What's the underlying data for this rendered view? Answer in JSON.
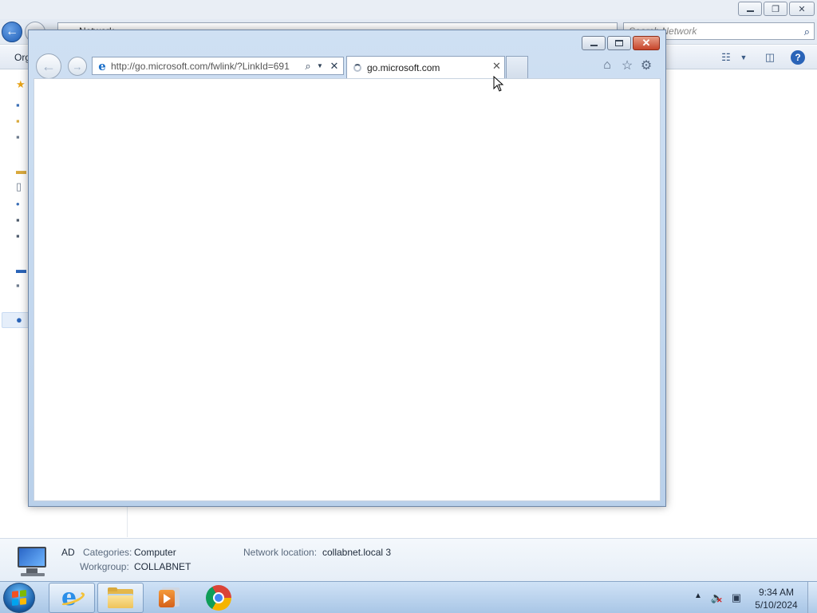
{
  "explorer": {
    "address_text": "Network",
    "search_placeholder": "Search Network",
    "organize_label": "Organize",
    "details": {
      "computer_name": "AD",
      "categories_label": "Categories:",
      "categories_value": "Computer",
      "workgroup_label": "Workgroup:",
      "workgroup_value": "COLLABNET",
      "network_location_label": "Network location:",
      "network_location_value": "collabnet.local 3"
    }
  },
  "ie": {
    "url": "http://go.microsoft.com/fwlink/?LinkId=691",
    "tab_title": "go.microsoft.com",
    "icons": [
      "back-icon",
      "forward-icon",
      "ie-favicon",
      "search-icon",
      "dropdown-icon",
      "stop-icon",
      "loading-spinner-icon",
      "close-tab-icon",
      "home-icon",
      "favorites-star-icon",
      "settings-gear-icon"
    ]
  },
  "taskbar": {
    "pinned": [
      "internet-explorer-icon",
      "windows-explorer-icon",
      "media-player-icon",
      "chrome-icon"
    ],
    "time": "9:34 AM",
    "date": "5/10/2024"
  },
  "colors": {
    "taskbar": "#a9c6e6",
    "ie_frame": "#b9d0ea",
    "close_button": "#c7452b"
  }
}
